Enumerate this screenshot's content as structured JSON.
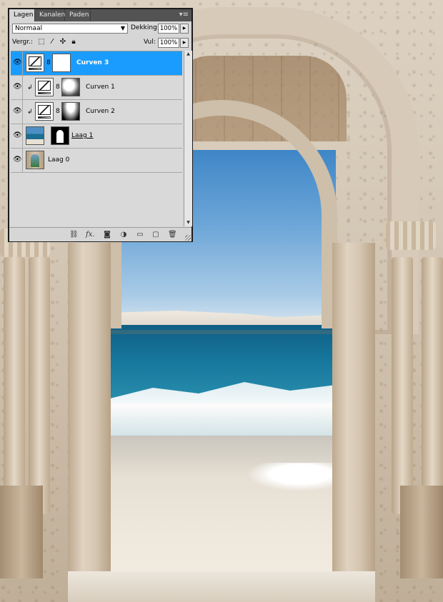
{
  "panel": {
    "tabs": [
      {
        "label": "Lagen",
        "active": true
      },
      {
        "label": "Kanalen",
        "active": false
      },
      {
        "label": "Paden",
        "active": false
      }
    ],
    "menu_icon": "panel-menu-icon",
    "blend_mode": "Normaal",
    "opacity_label": "Dekking:",
    "opacity_value": "100%",
    "lock_label": "Vergr.:",
    "fill_label": "Vul:",
    "fill_value": "100%",
    "lock_icons": [
      "lock-transparent-icon",
      "lock-brush-icon",
      "lock-move-icon",
      "lock-all-icon"
    ],
    "layers": [
      {
        "name": "Curven 3",
        "selected": true,
        "clipped": false,
        "type": "curves-adjustment",
        "mask": "white"
      },
      {
        "name": "Curven 1",
        "selected": false,
        "clipped": true,
        "type": "curves-adjustment",
        "mask": "soft"
      },
      {
        "name": "Curven 2",
        "selected": false,
        "clipped": true,
        "type": "curves-adjustment",
        "mask": "dark"
      },
      {
        "name": "Laag 1",
        "selected": false,
        "clipped": false,
        "type": "pixel-with-mask",
        "mask": "arch"
      },
      {
        "name": "Laag 0",
        "selected": false,
        "clipped": false,
        "type": "pixel"
      }
    ],
    "footer_icons": [
      "link-layers-icon",
      "fx-icon",
      "add-mask-icon",
      "adjustment-layer-icon",
      "new-group-icon",
      "new-layer-icon",
      "delete-layer-icon"
    ],
    "footer_fx_label": "fx.",
    "selection_color": "#1a9cff"
  }
}
